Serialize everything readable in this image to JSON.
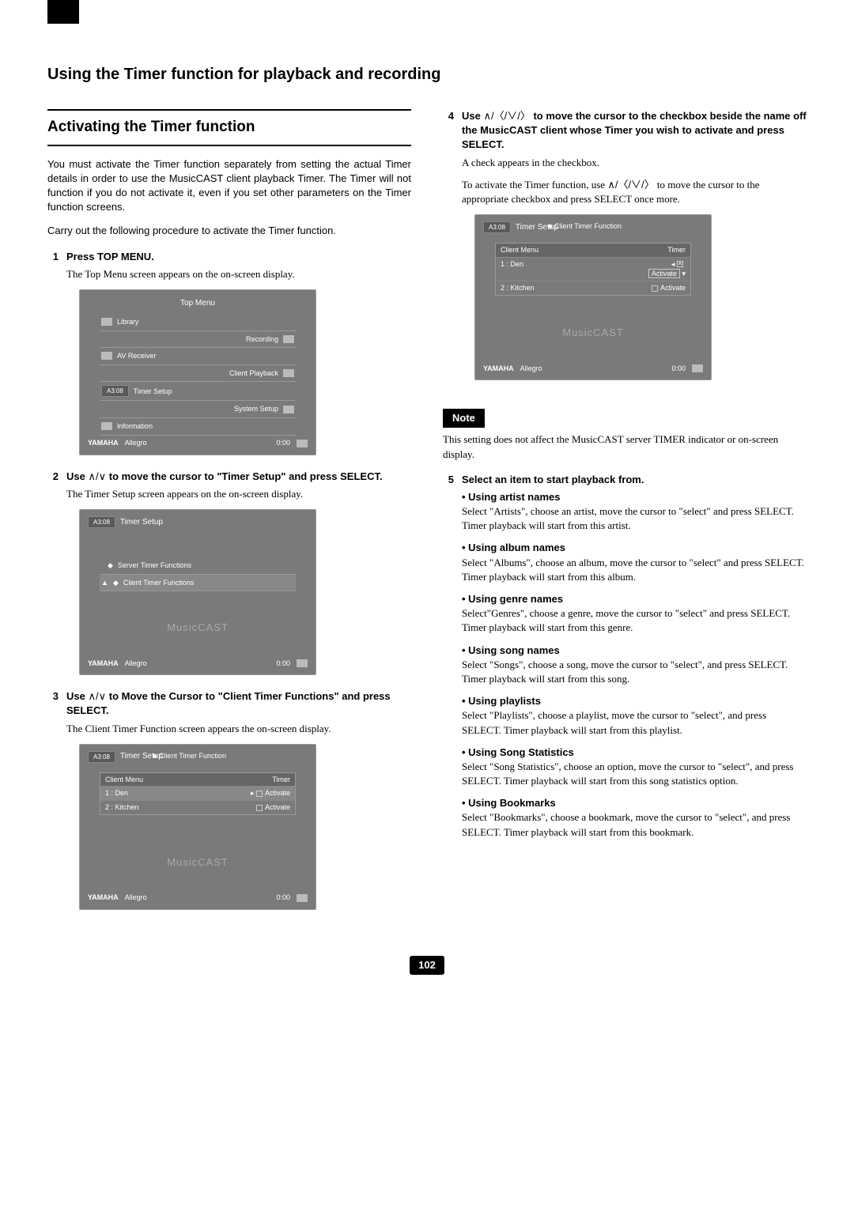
{
  "page_title": "Using the Timer function for playback and recording",
  "section": "Activating the Timer function",
  "intro1": "You must activate the Timer function separately from setting the actual Timer details in order to use the MusicCAST client playback Timer. The Timer will not function if you do not activate it, even if you set other parameters on the Timer function screens.",
  "intro2": "Carry out the following procedure to activate the Timer function.",
  "steps": {
    "s1": {
      "n": "1",
      "h": "Press TOP MENU.",
      "b": "The Top Menu screen appears on the on-screen display."
    },
    "s2": {
      "n": "2",
      "h_pre": "Use ",
      "h_post": " to move the cursor to \"Timer Setup\" and press SELECT.",
      "arrows": "∧/∨",
      "b": "The Timer Setup screen appears on the on-screen display."
    },
    "s3": {
      "n": "3",
      "h_pre": "Use ",
      "h_post": " to Move the Cursor to \"Client Timer Functions\" and press SELECT.",
      "arrows": "∧/∨",
      "b": "The Client Timer Function screen appears the on-screen display."
    },
    "s4": {
      "n": "4",
      "h_pre": "Use ",
      "h_post": " to move the cursor to the checkbox beside the name off the MusicCAST client whose Timer you wish to activate and press SELECT.",
      "arrows": "∧/〈/∨/〉",
      "b": "A check appears in the checkbox.",
      "b2_pre": "To activate the Timer function, use ",
      "b2_arrows": "∧/〈/∨/〉",
      "b2_post": " to move the cursor to the appropriate checkbox and press SELECT once more."
    },
    "s5": {
      "n": "5",
      "h": "Select an item to start playback from."
    }
  },
  "note_label": "Note",
  "note_text": "This setting does not affect the MusicCAST server TIMER indicator or on-screen display.",
  "picks": {
    "artist": {
      "h": "Using artist names",
      "b": "Select \"Artists\", choose an artist, move the cursor to \"select\" and press SELECT. Timer playback will start from this artist."
    },
    "album": {
      "h": "Using album names",
      "b": "Select \"Albums\", choose an album, move the cursor to \"select\" and press SELECT. Timer playback will start from this album."
    },
    "genre": {
      "h": "Using genre names",
      "b": "Select\"Genres\", choose a genre, move the cursor to \"select\" and press SELECT. Timer playback will start from this genre."
    },
    "song": {
      "h": "Using song names",
      "b": "Select \"Songs\", choose a song, move the cursor to \"select\", and press SELECT. Timer playback will start from this song."
    },
    "playlist": {
      "h": "Using playlists",
      "b": "Select \"Playlists\", choose a playlist, move the cursor to \"select\", and press SELECT. Timer playback will start from this playlist."
    },
    "stat": {
      "h": "Using Song Statistics",
      "b": "Select \"Song Statistics\", choose an option, move the cursor to \"select\", and press SELECT. Timer playback will start from this song statistics option."
    },
    "bookmark": {
      "h": "Using Bookmarks",
      "b": "Select \"Bookmarks\", choose a bookmark, move the cursor to \"select\", and press SELECT. Timer playback will start from this bookmark."
    }
  },
  "scr": {
    "topmenu": {
      "title": "Top Menu",
      "items": [
        "Library",
        "AV Receiver",
        "Timer Setup",
        "Information"
      ],
      "ritems": [
        "Recording",
        "Client Playback",
        "System Setup"
      ]
    },
    "timersetup": {
      "title": "Timer Setup",
      "rows": [
        "Server Timer Functions",
        "Client Timer Functions"
      ]
    },
    "client": {
      "title": "Timer Setup",
      "sub": "Client Timer Function",
      "hdr1": "Client Menu",
      "hdr2": "Timer",
      "r1": "1 : Den",
      "r2": "2 : Kitchen",
      "act": "Activate"
    },
    "brand": "MusicCAST",
    "foot_brand": "YAMAHA",
    "foot_track": "Allegro",
    "foot_time": "0:00",
    "clock": "A3:08"
  },
  "page_number": "102"
}
